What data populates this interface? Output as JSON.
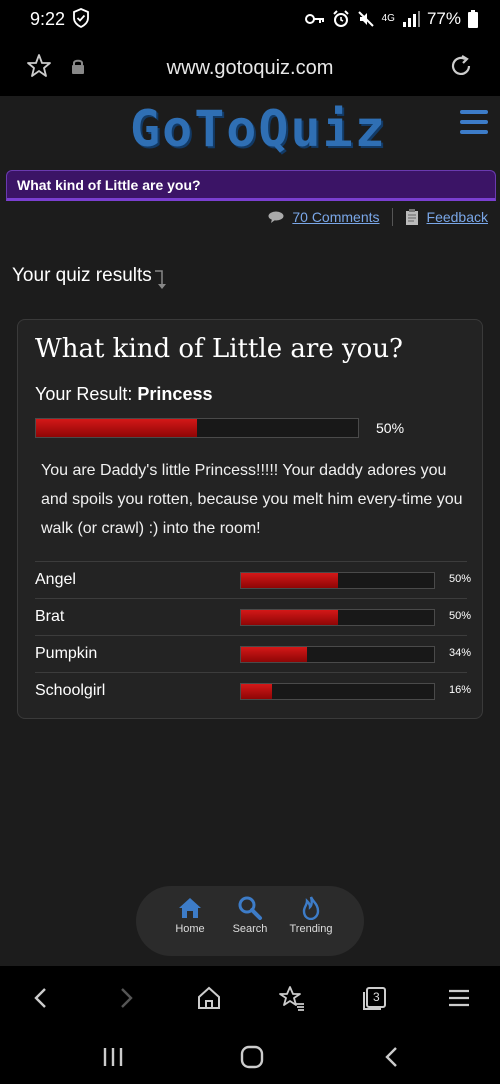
{
  "status_bar": {
    "time": "9:22",
    "battery": "77%",
    "network": "4G"
  },
  "address_bar": {
    "url": "www.gotoquiz.com"
  },
  "header": {
    "logo_text": "GoToQuiz"
  },
  "quiz_title_bar": "What kind of Little are you?",
  "links": {
    "comments": "70 Comments",
    "feedback": "Feedback"
  },
  "results_heading": "Your quiz results",
  "card": {
    "title": "What kind of Little are you?",
    "result_label": "Your Result:",
    "result_value": "Princess",
    "result_percent": 50,
    "result_percent_label": "50%",
    "description": "You are Daddy's little Princess!!!!! Your daddy adores you and spoils you rotten, because you melt him every-time you walk (or crawl) :) into the room!",
    "other_results": [
      {
        "name": "Angel",
        "percent": 50,
        "label": "50%"
      },
      {
        "name": "Brat",
        "percent": 50,
        "label": "50%"
      },
      {
        "name": "Pumpkin",
        "percent": 34,
        "label": "34%"
      },
      {
        "name": "Schoolgirl",
        "percent": 16,
        "label": "16%"
      }
    ]
  },
  "bottom_nav": {
    "home": "Home",
    "search": "Search",
    "trending": "Trending"
  },
  "browser_bar": {
    "tabs_count": "3"
  },
  "colors": {
    "accent_blue": "#2f6fb4",
    "title_purple": "#3b1466",
    "bar_red": "#c41010",
    "link_blue": "#7aa7e8"
  }
}
